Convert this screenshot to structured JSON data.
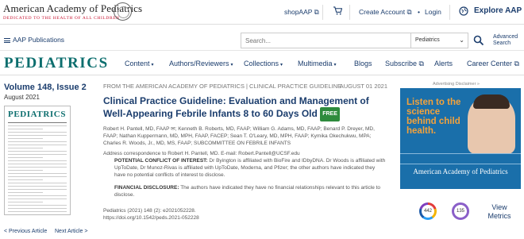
{
  "topbar": {
    "org_name": "American Academy of Pediatrics",
    "org_tagline": "DEDICATED TO THE HEALTH OF ALL CHILDREN",
    "shop_label": "shopAAP ⧉",
    "account_label": "Create Account ⧉",
    "login_label": "Login",
    "explore_label": "Explore AAP"
  },
  "searchbar": {
    "publications_label": "AAP Publications",
    "search_placeholder": "Search...",
    "scope_selected": "Pediatrics",
    "advanced_label": "Advanced Search"
  },
  "nav": {
    "logo": "PEDIATRICS",
    "items": [
      {
        "label": "Content"
      },
      {
        "label": "Authors/Reviewers"
      },
      {
        "label": "Collections"
      },
      {
        "label": "Multimedia"
      },
      {
        "label": "Blogs"
      },
      {
        "label": "Subscribe ⧉"
      },
      {
        "label": "Alerts"
      },
      {
        "label": "Career Center ⧉"
      }
    ]
  },
  "issue": {
    "volume": "Volume 148, Issue 2",
    "date": "August 2021",
    "cover_title": "PEDIATRICS",
    "prev_label": "< Previous Article",
    "next_label": "Next Article >"
  },
  "article": {
    "category": "FROM THE AMERICAN ACADEMY OF PEDIATRICS | CLINICAL PRACTICE GUIDELINE",
    "pub_date": "AUGUST 01 2021",
    "title": "Clinical Practice Guideline: Evaluation and Management of Well-Appearing Febrile Infants 8 to 60 Days Old",
    "free_badge": "FREE",
    "authors": "Robert H. Pantell, MD, FAAP ✉; Kenneth B. Roberts, MD, FAAP; William G. Adams, MD, FAAP; Benard P. Dreyer, MD, FAAP; Nathan Kuppermann, MD, MPH, FAAP, FACEP; Sean T. O'Leary, MD, MPH, FAAP; Kymika Okechukwu, MPA; Charles R. Woods, Jr., MD, MS, FAAP; SUBCOMMITTEE ON FEBRILE INFANTS",
    "correspondence": "Address correspondence to Robert H. Pantell, MD. E-mail: Robert.Pantell@UCSF.edu",
    "conflict_heading": "POTENTIAL CONFLICT OF INTEREST:",
    "conflict_text": "Dr Byington is affiliated with BioFire and IDbyDNA. Dr Woods is affiliated with UpToDate, Dr Munoz-Rivas is affiliated with UpToDate, Moderna, and Pfizer; the other authors have indicated they have no potential conflicts of interest to disclose.",
    "financial_heading": "FINANCIAL DISCLOSURE:",
    "financial_text": "The authors have indicated they have no financial relationships relevant to this article to disclose.",
    "citation": "Pediatrics (2021) 148 (2): e2021052228.",
    "doi": "https://doi.org/10.1542/peds.2021-052228"
  },
  "sidebar": {
    "ad_label": "Advertising Disclaimer »",
    "ad_headline": "Listen to the science behind child health.",
    "ad_footer": "American Academy of Pediatrics",
    "altmetric_score": "442",
    "dimensions_score": "135",
    "metrics_label": "View Metrics"
  }
}
